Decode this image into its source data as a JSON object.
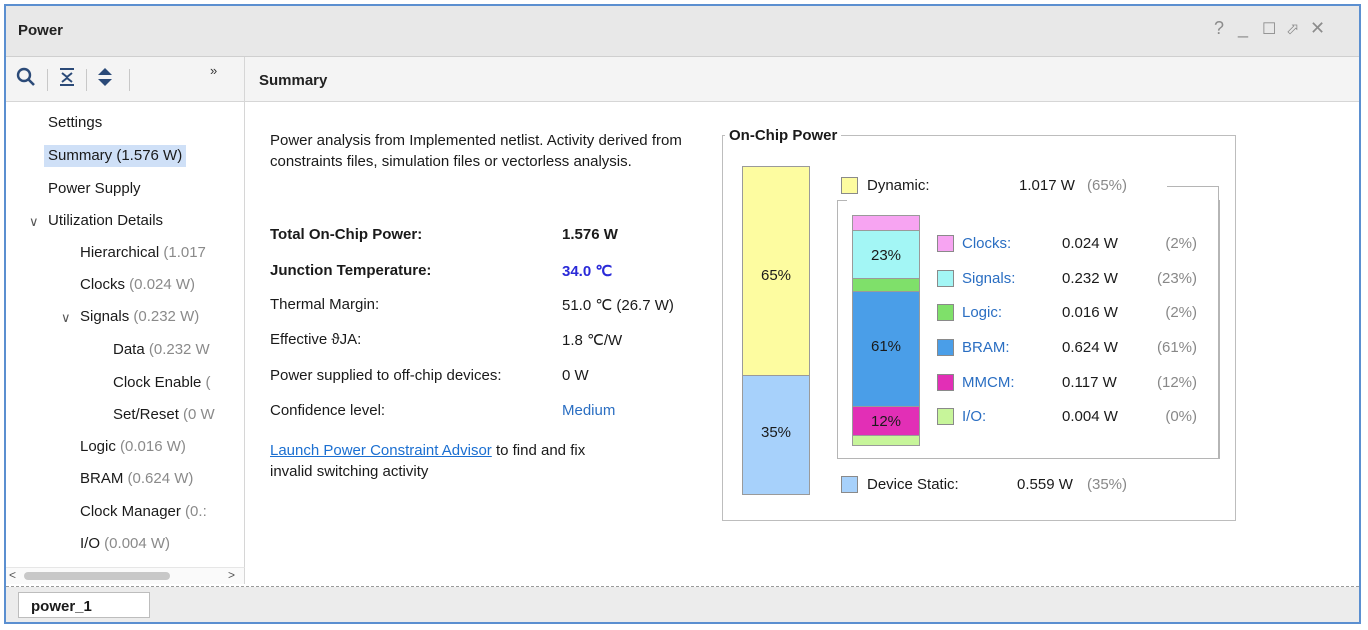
{
  "window": {
    "title": "Power",
    "controls": {
      "help": "?",
      "minimize": "_",
      "maximize": "☐",
      "restore": "⬀",
      "close": "✕"
    }
  },
  "toolbar": {
    "expand_more": "»"
  },
  "breadcrumb": {
    "title": "Summary"
  },
  "tree": {
    "settings": {
      "label": "Settings"
    },
    "summary": {
      "label": "Summary (1.576 W)"
    },
    "power_supply": {
      "label": "Power Supply"
    },
    "utilization": {
      "label": "Utilization Details"
    },
    "hierarchical": {
      "label": "Hierarchical",
      "value": " (1.017"
    },
    "clocks": {
      "label": "Clocks",
      "value": " (0.024 W)"
    },
    "signals": {
      "label": "Signals",
      "value": " (0.232 W)"
    },
    "data": {
      "label": "Data",
      "value": " (0.232 W"
    },
    "clock_enable": {
      "label": "Clock Enable",
      "value": " ("
    },
    "set_reset": {
      "label": "Set/Reset",
      "value": " (0 W"
    },
    "logic": {
      "label": "Logic",
      "value": " (0.016 W)"
    },
    "bram": {
      "label": "BRAM",
      "value": " (0.624 W)"
    },
    "clock_manager": {
      "label": "Clock Manager",
      "value": " (0.:"
    },
    "io": {
      "label": "I/O",
      "value": " (0.004 W)"
    }
  },
  "scrollbar": {
    "left_arrow": "<",
    "right_arrow": ">"
  },
  "bottom_tab": "power_1",
  "summary": {
    "intro": "Power analysis from Implemented netlist. Activity derived from constraints files, simulation files or vectorless analysis.",
    "total_label": "Total On-Chip Power:",
    "total_value": "1.576 W",
    "junction_label": "Junction Temperature:",
    "junction_value": "34.0 ℃",
    "thermal_label": "Thermal Margin:",
    "thermal_value": "51.0 ℃ (26.7 W)",
    "theta_label": "Effective ϑJA:",
    "theta_value": "1.8 ℃/W",
    "offchip_label": "Power supplied to off-chip devices:",
    "offchip_value": "0 W",
    "confidence_label": "Confidence level:",
    "confidence_value": "Medium",
    "advisor_link": "Launch Power Constraint Advisor",
    "advisor_text_1": " to find and fix",
    "advisor_text_2": "invalid switching activity"
  },
  "onchip": {
    "title": "On-Chip Power",
    "dynamic": {
      "label": "Dynamic:",
      "value": "1.017 W",
      "pct": "(65%)",
      "bar_text": "65%",
      "color": "#fdfca0"
    },
    "static": {
      "label": "Device Static:",
      "value": "0.559 W",
      "pct": "(35%)",
      "bar_text": "35%",
      "color": "#a7d1fb"
    },
    "items": [
      {
        "label": "Clocks:",
        "value": "0.024 W",
        "pct": "(2%)",
        "color": "#f7a4f2",
        "bar_text": ""
      },
      {
        "label": "Signals:",
        "value": "0.232 W",
        "pct": "(23%)",
        "color": "#a3f6f5",
        "bar_text": "23%"
      },
      {
        "label": "Logic:",
        "value": "0.016 W",
        "pct": "(2%)",
        "color": "#7fe06a",
        "bar_text": ""
      },
      {
        "label": "BRAM:",
        "value": "0.624 W",
        "pct": "(61%)",
        "color": "#4a9ee8",
        "bar_text": "61%"
      },
      {
        "label": "MMCM:",
        "value": "0.117 W",
        "pct": "(12%)",
        "color": "#e22fb6",
        "bar_text": "12%"
      },
      {
        "label": "I/O:",
        "value": "0.004 W",
        "pct": "(0%)",
        "color": "#c7f59a",
        "bar_text": ""
      }
    ]
  }
}
